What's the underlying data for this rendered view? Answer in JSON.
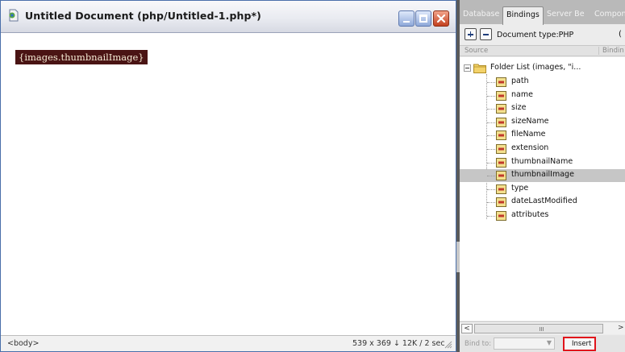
{
  "document_window": {
    "title": "Untitled Document (php/Untitled-1.php*)",
    "dynamic_text": "{images.thumbnailImage}",
    "tag_selector": "<body>",
    "status_info": "539 x 369 ↓ 12K / 2 sec"
  },
  "bindings_panel": {
    "tabs": [
      {
        "label": "Database"
      },
      {
        "label": "Bindings",
        "active": true
      },
      {
        "label": "Server Be"
      },
      {
        "label": "Compone"
      }
    ],
    "document_type": "Document type:PHP",
    "overflow_char": "(",
    "columns": {
      "source": "Source",
      "binding": "Bindin"
    },
    "tree": {
      "root_label": "Folder List (images, \"i...",
      "items": [
        {
          "label": "path"
        },
        {
          "label": "name"
        },
        {
          "label": "size"
        },
        {
          "label": "sizeName"
        },
        {
          "label": "fileName"
        },
        {
          "label": "extension"
        },
        {
          "label": "thumbnailName"
        },
        {
          "label": "thumbnailImage",
          "selected": true
        },
        {
          "label": "type"
        },
        {
          "label": "dateLastModified"
        },
        {
          "label": "attributes"
        }
      ]
    },
    "scrollbar": {
      "left_arrow": "<",
      "right_arrow": ">"
    },
    "bind_to_label": "Bind to:",
    "insert_label": "Insert"
  },
  "colors": {
    "dynamic_text_bg": "#4a1414",
    "highlight_border": "#e0141b",
    "selected_row": "#c6c6c6"
  }
}
